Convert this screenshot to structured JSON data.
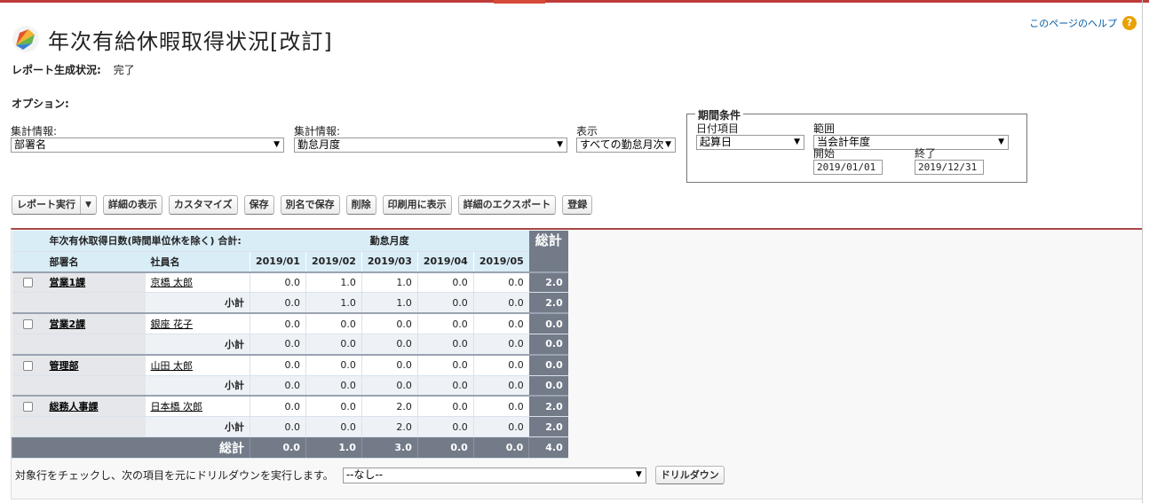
{
  "page": {
    "title": "年次有給休暇取得状況[改訂]",
    "help_link": "このページのヘルプ",
    "status_label": "レポート生成状況:",
    "status_value": "完了",
    "options_label": "オプション:"
  },
  "options": {
    "summary1_label": "集計情報:",
    "summary1_value": "部署名",
    "summary2_label": "集計情報:",
    "summary2_value": "勤怠月度",
    "display_label": "表示",
    "display_value": "すべての勤怠月次",
    "period": {
      "legend": "期間条件",
      "date_field_label": "日付項目",
      "date_field_value": "起算日",
      "range_label": "範囲",
      "range_value": "当会計年度",
      "start_label": "開始",
      "start_value": "2019/01/01",
      "end_label": "終了",
      "end_value": "2019/12/31"
    }
  },
  "toolbar": {
    "run": "レポート実行",
    "show_details": "詳細の表示",
    "customize": "カスタマイズ",
    "save": "保存",
    "save_as": "別名で保存",
    "delete": "削除",
    "printable": "印刷用に表示",
    "export": "詳細のエクスポート",
    "subscribe": "登録"
  },
  "report": {
    "measure_header": "年次有休取得日数(時間単位休を除く) 合計:",
    "group_header": "勤怠月度",
    "total_header": "総計",
    "dept_col": "部署名",
    "emp_col": "社員名",
    "months": [
      "2019/01",
      "2019/02",
      "2019/03",
      "2019/04",
      "2019/05"
    ],
    "subtotal_label": "小計",
    "grand_label": "総計",
    "groups": [
      {
        "dept": "営業1課",
        "emp": "京橋 太郎",
        "values": [
          "0.0",
          "1.0",
          "1.0",
          "0.0",
          "0.0"
        ],
        "total": "2.0",
        "sub_values": [
          "0.0",
          "1.0",
          "1.0",
          "0.0",
          "0.0"
        ],
        "sub_total": "2.0"
      },
      {
        "dept": "営業2課",
        "emp": "銀座 花子",
        "values": [
          "0.0",
          "0.0",
          "0.0",
          "0.0",
          "0.0"
        ],
        "total": "0.0",
        "sub_values": [
          "0.0",
          "0.0",
          "0.0",
          "0.0",
          "0.0"
        ],
        "sub_total": "0.0"
      },
      {
        "dept": "管理部",
        "emp": "山田 太郎",
        "values": [
          "0.0",
          "0.0",
          "0.0",
          "0.0",
          "0.0"
        ],
        "total": "0.0",
        "sub_values": [
          "0.0",
          "0.0",
          "0.0",
          "0.0",
          "0.0"
        ],
        "sub_total": "0.0"
      },
      {
        "dept": "総務人事課",
        "emp": "日本橋 次郎",
        "values": [
          "0.0",
          "0.0",
          "2.0",
          "0.0",
          "0.0"
        ],
        "total": "2.0",
        "sub_values": [
          "0.0",
          "0.0",
          "2.0",
          "0.0",
          "0.0"
        ],
        "sub_total": "2.0"
      }
    ],
    "grand_values": [
      "0.0",
      "1.0",
      "3.0",
      "0.0",
      "0.0"
    ],
    "grand_total": "4.0"
  },
  "drilldown": {
    "text": "対象行をチェックし、次の項目を元にドリルダウンを実行します。",
    "select_value": "--なし--",
    "button": "ドリルダウン"
  }
}
